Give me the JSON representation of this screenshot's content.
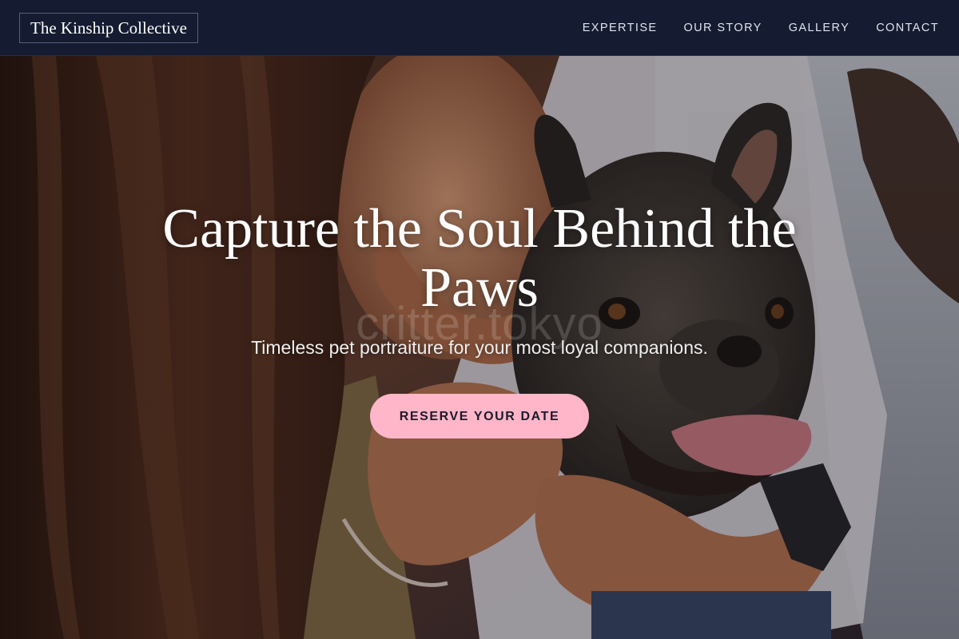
{
  "header": {
    "brand": "The Kinship Collective",
    "nav": [
      {
        "label": "EXPERTISE"
      },
      {
        "label": "OUR STORY"
      },
      {
        "label": "GALLERY"
      },
      {
        "label": "CONTACT"
      }
    ]
  },
  "hero": {
    "title": "Capture the Soul Behind the Paws",
    "subtitle": "Timeless pet portraiture for your most loyal companions.",
    "cta_label": "RESERVE YOUR DATE",
    "watermark": "critter.tokyo"
  },
  "colors": {
    "header_bg": "#151b30",
    "cta_bg": "#ffb6c8",
    "cta_text": "#1c1a2a",
    "heading_text": "#ffffff"
  }
}
